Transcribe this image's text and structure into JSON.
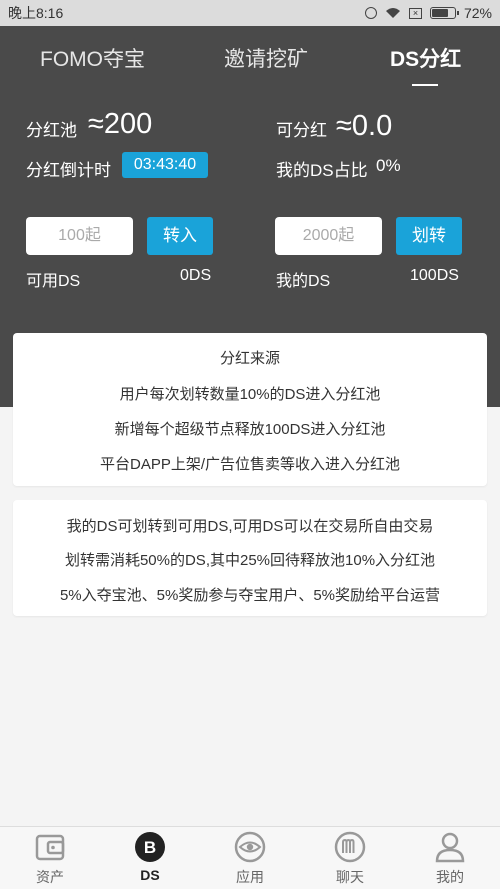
{
  "status_bar": {
    "time": "晚上8:16",
    "battery": "72%",
    "battery_level": 0.72
  },
  "tabs": [
    {
      "label": "FOMO夺宝",
      "active": false
    },
    {
      "label": "邀请挖矿",
      "active": false
    },
    {
      "label": "DS分红",
      "active": true
    }
  ],
  "pool": {
    "label": "分红池",
    "value": "≈200"
  },
  "distributable": {
    "label": "可分红",
    "value": "≈0.0"
  },
  "countdown": {
    "label": "分红倒计时",
    "value": "03:43:40"
  },
  "my_share": {
    "label": "我的DS占比",
    "value": "0%"
  },
  "transfer_in": {
    "placeholder": "100起",
    "button": "转入",
    "available_label": "可用DS",
    "available_value": "0DS"
  },
  "transfer_out": {
    "placeholder": "2000起",
    "button": "划转",
    "mine_label": "我的DS",
    "mine_value": "100DS"
  },
  "source_card": {
    "title": "分红来源",
    "lines": [
      "用户每次划转数量10%的DS进入分红池",
      "新增每个超级节点释放100DS进入分红池",
      "平台DAPP上架/广告位售卖等收入进入分红池"
    ]
  },
  "rules_card": {
    "lines": [
      "我的DS可划转到可用DS,可用DS可以在交易所自由交易",
      "划转需消耗50%的DS,其中25%回待释放池10%入分红池",
      "5%入夺宝池、5%奖励参与夺宝用户、5%奖励给平台运营"
    ]
  },
  "bottom_nav": [
    {
      "label": "资产",
      "icon": "wallet-icon",
      "active": false
    },
    {
      "label": "DS",
      "icon": "ds-b-icon",
      "active": true
    },
    {
      "label": "应用",
      "icon": "eye-icon",
      "active": false
    },
    {
      "label": "聊天",
      "icon": "chat-m-icon",
      "active": false
    },
    {
      "label": "我的",
      "icon": "user-icon",
      "active": false
    }
  ],
  "colors": {
    "accent": "#1aa3d9",
    "header_bg": "#4a4a4a",
    "page_bg": "#f4f4f4"
  }
}
